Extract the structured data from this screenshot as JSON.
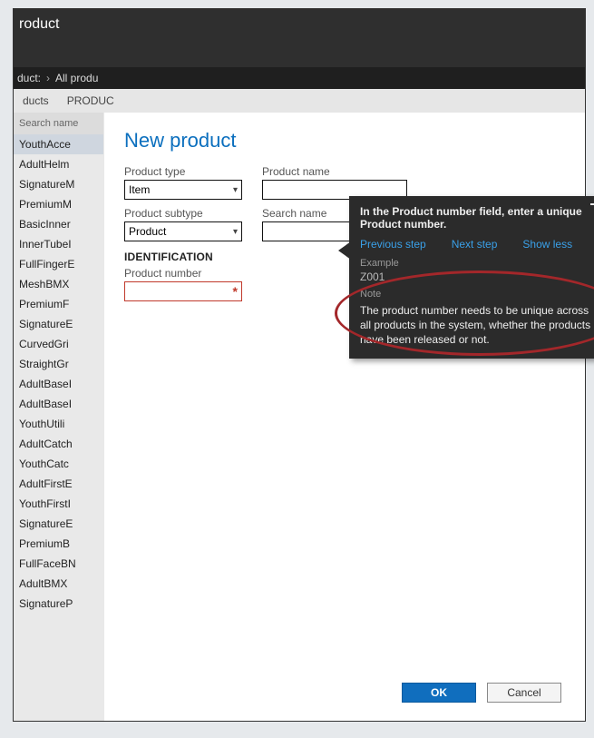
{
  "header": {
    "title": "roduct"
  },
  "breadcrumb": {
    "a": "duct:",
    "b": "All produ"
  },
  "tabs": {
    "a": "ducts",
    "b": "PRODUC"
  },
  "left": {
    "searchHeader": "Search name",
    "rows": [
      "YouthAcce",
      "AdultHelm",
      "SignatureM",
      "PremiumM",
      "BasicInner",
      "InnerTubeI",
      "FullFingerE",
      "MeshBMX",
      "PremiumF",
      "SignatureE",
      "CurvedGri",
      "StraightGr",
      "AdultBaseI",
      "AdultBaseI",
      "YouthUtili",
      "AdultCatch",
      "YouthCatc",
      "AdultFirstE",
      "YouthFirstI",
      "SignatureE",
      "PremiumB",
      "FullFaceBN",
      "AdultBMX",
      "SignatureP"
    ]
  },
  "panel": {
    "title": "New product",
    "labels": {
      "productType": "Product type",
      "productName": "Product name",
      "productSubtype": "Product subtype",
      "searchName": "Search name",
      "identification": "IDENTIFICATION",
      "productNumber": "Product number"
    },
    "values": {
      "productType": "Item",
      "productSubtype": "Product",
      "productName": "",
      "productNumber": ""
    },
    "footer": {
      "ok": "OK",
      "cancel": "Cancel"
    }
  },
  "callout": {
    "headline": "In the Product number field, enter a unique Product number.",
    "links": {
      "prev": "Previous step",
      "next": "Next step",
      "less": "Show less"
    },
    "exampleLabel": "Example",
    "exampleValue": "Z001",
    "noteLabel": "Note",
    "noteBody": "The product number needs to be unique across all products in the system, whether the products have been released or not."
  }
}
